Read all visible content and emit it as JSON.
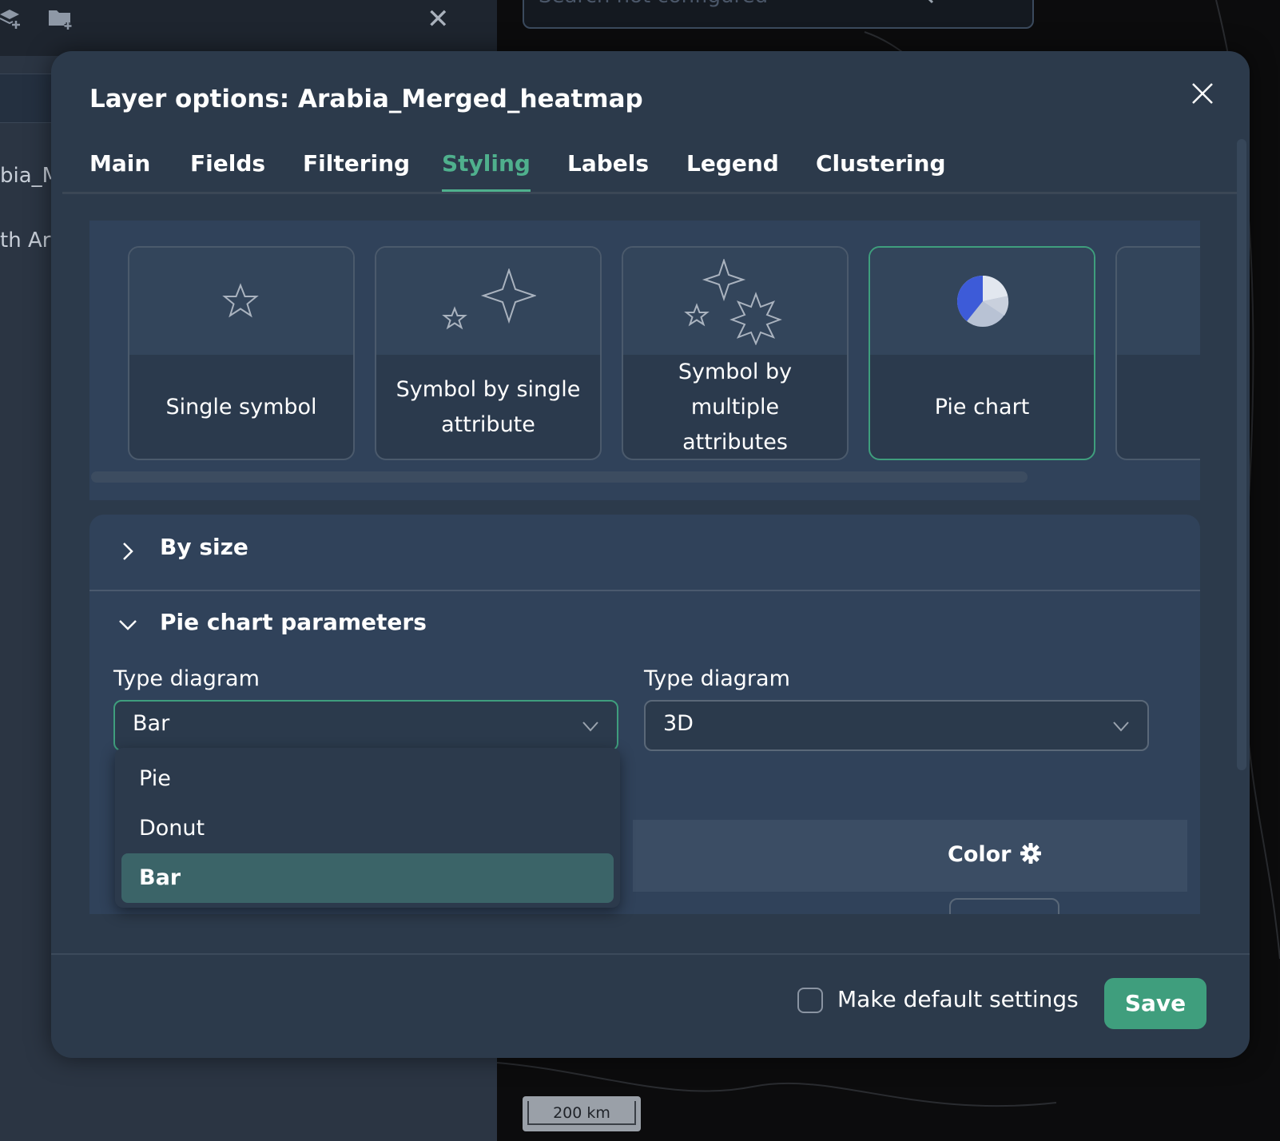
{
  "sidebar": {
    "layer_name_partial": "bia_M",
    "layer_name_partial_2": "th Ar"
  },
  "map": {
    "search_placeholder": "Search not configured",
    "scale_label": "200 km"
  },
  "modal": {
    "title": "Layer options: Arabia_Merged_heatmap",
    "tabs": [
      {
        "label": "Main"
      },
      {
        "label": "Fields"
      },
      {
        "label": "Filtering"
      },
      {
        "label": "Styling",
        "active": true
      },
      {
        "label": "Labels"
      },
      {
        "label": "Legend"
      },
      {
        "label": "Clustering"
      }
    ],
    "style_cards": [
      {
        "label": "Single symbol",
        "icon": "single-star-icon"
      },
      {
        "label": "Symbol by single attribute",
        "icon": "stars-single-attribute-icon"
      },
      {
        "label": "Symbol by multiple attributes",
        "icon": "stars-multiple-attributes-icon"
      },
      {
        "label": "Pie chart",
        "icon": "pie-chart-icon",
        "selected": true
      },
      {
        "label": "",
        "icon": ""
      }
    ],
    "sections": {
      "by_size": "By size",
      "pie_params": "Pie chart parameters"
    },
    "fields": {
      "type_diagram_label_1": "Type diagram",
      "type_diagram_value_1": "Bar",
      "type_diagram_label_2": "Type diagram",
      "type_diagram_value_2": "3D"
    },
    "dropdown": {
      "options": [
        {
          "label": "Pie"
        },
        {
          "label": "Donut"
        },
        {
          "label": "Bar",
          "selected": true
        }
      ]
    },
    "table": {
      "color_header": "Color"
    },
    "footer": {
      "checkbox_label": "Make default settings",
      "save_label": "Save"
    }
  },
  "colors": {
    "accent": "#3f9e7d",
    "accent_text": "#4fb08d",
    "modal_bg": "#2c3a4b",
    "panel_bg": "#30425a",
    "selected_option_bg": "#3b6468",
    "pie_blue": "#3d5bd8"
  }
}
